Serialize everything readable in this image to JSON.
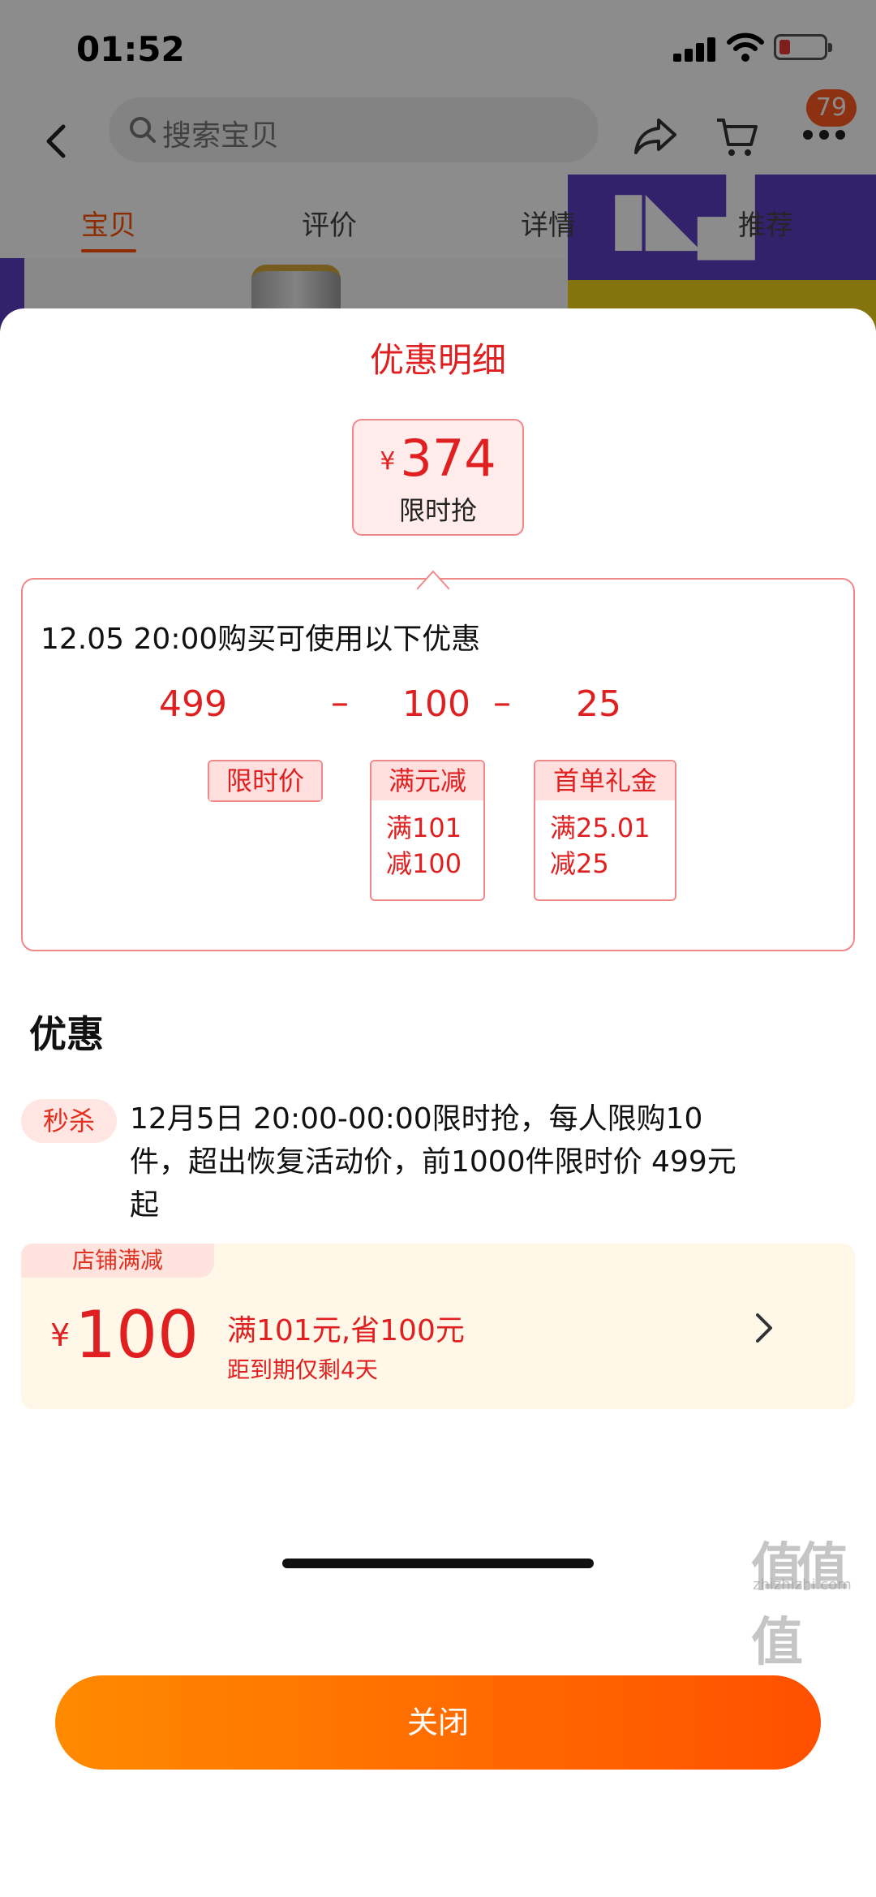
{
  "status_bar": {
    "time": "01:52"
  },
  "nav": {
    "search_placeholder": "搜索宝贝",
    "badge_count": "79"
  },
  "tabs": [
    "宝贝",
    "评价",
    "详情",
    "推荐"
  ],
  "sheet": {
    "title": "优惠明细",
    "price": {
      "currency": "¥",
      "value": "374",
      "label": "限时抢"
    },
    "calc": {
      "heading": "12.05 20:00购买可使用以下优惠",
      "values": [
        "499",
        "100",
        "25"
      ],
      "operators": [
        "–",
        "–"
      ],
      "items": [
        {
          "title": "限时价",
          "lines": []
        },
        {
          "title": "满元减",
          "lines": [
            "满101",
            "减100"
          ]
        },
        {
          "title": "首单礼金",
          "lines": [
            "满25.01",
            "减25"
          ]
        }
      ]
    },
    "section_title": "优惠",
    "flash_sale": {
      "tag": "秒杀",
      "line1": "12月5日 20:00-00:00限时抢，每人限购10",
      "line2": "件，超出恢复活动价，前1000件限时价 499元",
      "line3": "起"
    },
    "coupon": {
      "tag": "店铺满减",
      "currency": "¥",
      "amount": "100",
      "condition": "满101元,省100元",
      "expiry": "距到期仅剩4天"
    },
    "close_label": "关闭"
  },
  "colors": {
    "accent": "#e02020",
    "button_start": "#ff8a00",
    "button_end": "#ff5000"
  }
}
